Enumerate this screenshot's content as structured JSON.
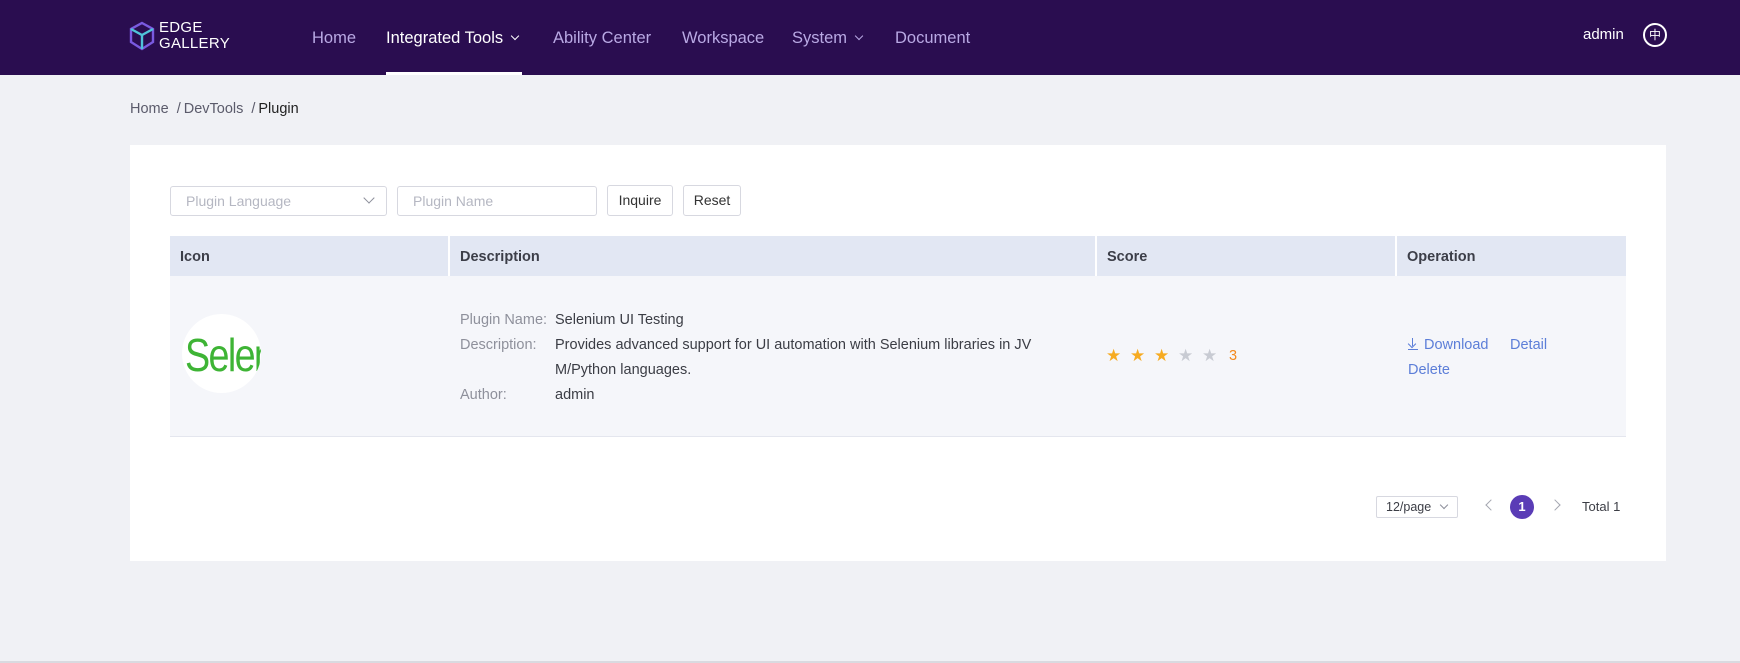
{
  "brand": {
    "line1": "EDGE",
    "line2": "GALLERY"
  },
  "nav": {
    "home": "Home",
    "integrated_tools": "Integrated Tools",
    "ability_center": "Ability Center",
    "workspace": "Workspace",
    "system": "System",
    "document": "Document"
  },
  "user": {
    "name": "admin",
    "lang_icon": "中"
  },
  "breadcrumb": {
    "home": "Home",
    "devtools": "DevTools",
    "current": "Plugin"
  },
  "filters": {
    "language_placeholder": "Plugin Language",
    "name_placeholder": "Plugin Name",
    "inquire_label": "Inquire",
    "reset_label": "Reset"
  },
  "table": {
    "headers": {
      "icon": "Icon",
      "description": "Description",
      "score": "Score",
      "operation": "Operation"
    },
    "rows": [
      {
        "icon_text": "Selen",
        "name_label": "Plugin Name:",
        "name": "Selenium UI Testing",
        "desc_label": "Description:",
        "desc_line1": "Provides advanced support for UI automation with Selenium libraries in JV",
        "desc_line2": "M/Python languages.",
        "author_label": "Author:",
        "author": "admin",
        "score": "3",
        "score_value": 3,
        "score_max": 5,
        "download_label": "Download",
        "detail_label": "Detail",
        "delete_label": "Delete"
      }
    ]
  },
  "pagination": {
    "page_size": "12/page",
    "current_page": "1",
    "total": "Total 1"
  },
  "colors": {
    "topbar": "#2a0d50",
    "accent": "#5a3cb6",
    "link": "#5c7ed8",
    "star": "#f6ab22"
  }
}
